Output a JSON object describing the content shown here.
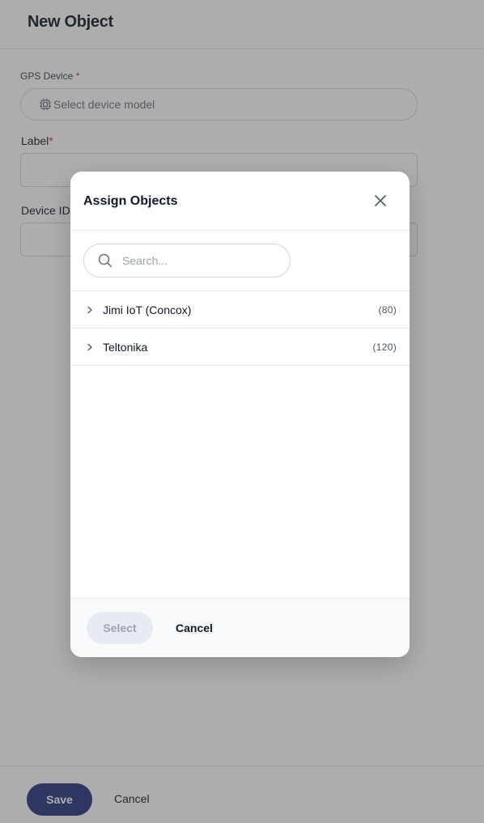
{
  "page": {
    "title": "New Object",
    "gps_device": {
      "label": "GPS Device",
      "required_mark": "*",
      "placeholder": "Select device model",
      "icon": "chip-icon"
    },
    "label_field": {
      "label": "Label",
      "required_mark": "*",
      "value": ""
    },
    "device_id_field": {
      "label": "Device ID",
      "value": ""
    },
    "footer": {
      "save_label": "Save",
      "cancel_label": "Cancel"
    }
  },
  "modal": {
    "title": "Assign Objects",
    "close_icon": "close-icon",
    "search": {
      "placeholder": "Search...",
      "value": "",
      "icon": "search-icon"
    },
    "items": [
      {
        "name": "Jimi IoT (Concox)",
        "count": "(80)",
        "icon": "chevron-right-icon"
      },
      {
        "name": "Teltonika",
        "count": "(120)",
        "icon": "chevron-right-icon"
      }
    ],
    "footer": {
      "select_label": "Select",
      "cancel_label": "Cancel"
    }
  },
  "colors": {
    "primary": "#26337a",
    "required": "#dc2626",
    "overlay": "rgba(60,60,60,0.42)",
    "disabled_button_bg": "#e8ebf3"
  }
}
